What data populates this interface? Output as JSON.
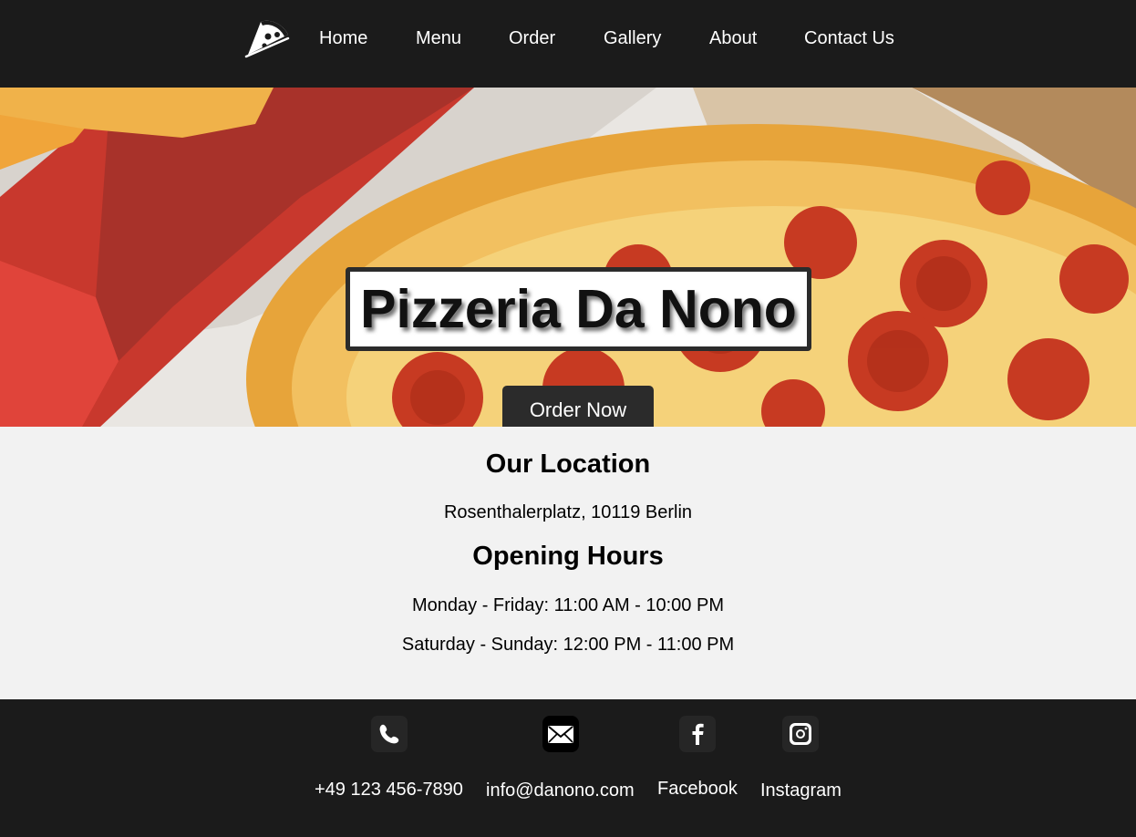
{
  "nav": {
    "logo_icon": "pizza-slice-icon",
    "items": [
      {
        "label": "Home"
      },
      {
        "label": "Menu"
      },
      {
        "label": "Order"
      },
      {
        "label": "Gallery"
      },
      {
        "label": "About"
      },
      {
        "label": "Contact Us"
      }
    ]
  },
  "hero": {
    "title": "Pizzeria Da Nono",
    "button_label": "Order Now",
    "background": "pepperoni-pizza-in-box-photo"
  },
  "location": {
    "heading": "Our Location",
    "address": "Rosenthalerplatz, 10119 Berlin"
  },
  "hours": {
    "heading": "Opening Hours",
    "weekdays": "Monday - Friday: 11:00 AM - 10:00 PM",
    "weekend": "Saturday - Sunday: 12:00 PM - 11:00 PM"
  },
  "footer": {
    "contacts": [
      {
        "icon": "phone-icon",
        "label": "+49 123 456-7890"
      },
      {
        "icon": "email-icon",
        "label": "info@danono.com"
      },
      {
        "icon": "facebook-icon",
        "label": "Facebook"
      },
      {
        "icon": "instagram-icon",
        "label": "Instagram"
      }
    ]
  },
  "colors": {
    "header_bg": "#1b1b1b",
    "footer_bg": "#1b1b1b",
    "info_bg": "#f2f2f2",
    "button_bg": "#2b2b2b"
  }
}
